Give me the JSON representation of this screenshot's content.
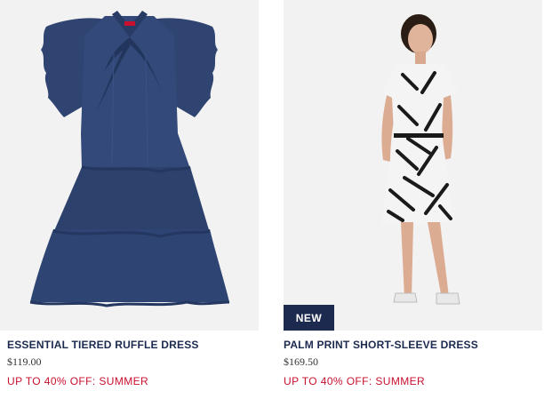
{
  "products": [
    {
      "name": "ESSENTIAL TIERED RUFFLE DRESS",
      "price": "$119.00",
      "promo": "UP TO 40% OFF: SUMMER",
      "image_alt": "Navy chambray tiered ruffle dress with neck tie",
      "badge": ""
    },
    {
      "name": "PALM PRINT SHORT-SLEEVE DRESS",
      "price": "$169.50",
      "promo": "UP TO 40% OFF: SUMMER",
      "image_alt": "Model wearing black and white palm print short-sleeve dress",
      "badge": "NEW"
    }
  ],
  "colors": {
    "brand_navy": "#1d2a4f",
    "promo_red": "#c8102e",
    "image_bg": "#f2f2f2",
    "dress_denim": "#2f4470"
  }
}
